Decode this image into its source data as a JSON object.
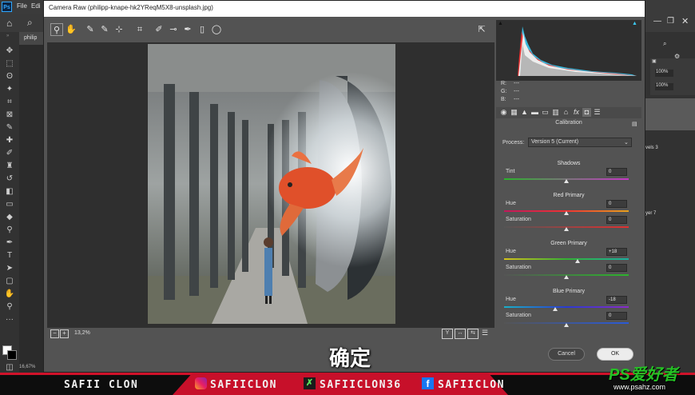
{
  "photoshop": {
    "logo": "Ps",
    "menu": [
      "File",
      "Edi"
    ],
    "doc_tab": "philip",
    "status_zoom": "16,67%",
    "right_panel": {
      "zoom_a": "100%",
      "zoom_b": "100%",
      "layer_a": "vels 3",
      "layer_b": "yer 7"
    }
  },
  "camera_raw": {
    "title": "Camera Raw (philipp-knape-hk2YReqM5X8-unsplash.jpg)",
    "zoom_level": "13,2%",
    "rgb_readout": {
      "r": "R:",
      "g": "G:",
      "b": "B:",
      "r_val": "---",
      "g_val": "---",
      "b_val": "---"
    },
    "panel_title": "Calibration",
    "process": {
      "label": "Process:",
      "value": "Version 5 (Current)"
    },
    "shadows": {
      "title": "Shadows",
      "tint_label": "Tint",
      "tint_value": "0",
      "tint_level": 0
    },
    "red_primary": {
      "title": "Red Primary",
      "hue_label": "Hue",
      "hue_value": "0",
      "hue_level": 0,
      "sat_label": "Saturation",
      "sat_value": "0",
      "sat_level": 0
    },
    "green_primary": {
      "title": "Green Primary",
      "hue_label": "Hue",
      "hue_value": "+18",
      "hue_level": 18,
      "sat_label": "Saturation",
      "sat_value": "0",
      "sat_level": 0
    },
    "blue_primary": {
      "title": "Blue Primary",
      "hue_label": "Hue",
      "hue_value": "-18",
      "hue_level": -18,
      "sat_label": "Saturation",
      "sat_value": "0",
      "sat_level": 0
    },
    "cancel_label": "Cancel",
    "ok_label": "OK"
  },
  "subtitle": "确定",
  "banner": {
    "channel": "SAFII CLON",
    "instagram": "SAFIICLON",
    "other": "SAFIICLON36",
    "facebook": "SAFIICLON",
    "accent_color": "#d0122a"
  },
  "watermark": {
    "logo": "PS爱好者",
    "url": "www.psahz.com"
  }
}
